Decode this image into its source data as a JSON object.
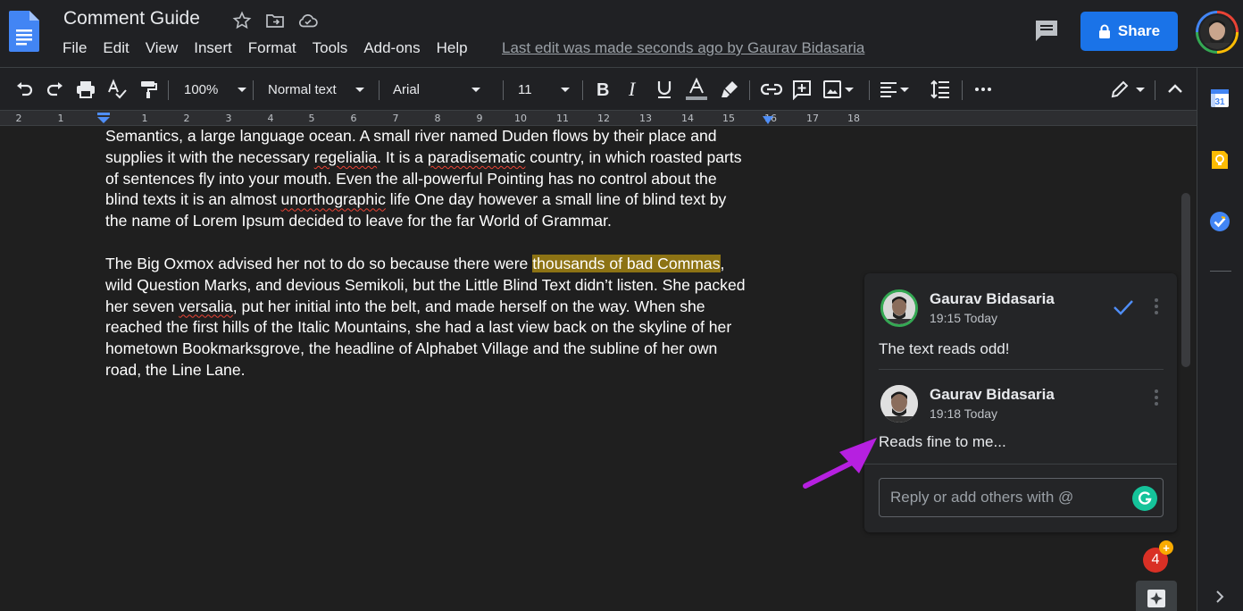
{
  "header": {
    "title": "Comment Guide",
    "menu": [
      "File",
      "Edit",
      "View",
      "Insert",
      "Format",
      "Tools",
      "Add-ons",
      "Help"
    ],
    "last_edit": "Last edit was made seconds ago by Gaurav Bidasaria",
    "share_label": "Share"
  },
  "toolbar": {
    "zoom": "100%",
    "style": "Normal text",
    "font": "Arial",
    "font_size": "11"
  },
  "ruler": {
    "labels": [
      "2",
      "1",
      "1",
      "2",
      "3",
      "4",
      "5",
      "6",
      "7",
      "8",
      "9",
      "10",
      "11",
      "12",
      "13",
      "14",
      "15",
      "16",
      "17",
      "18"
    ]
  },
  "document": {
    "paragraph1": {
      "l1": "Semantics, a large language ocean. A small river named Duden flows by their place and",
      "l2a": "supplies it with the necessary ",
      "l2b": "regelialia",
      "l2c": ". It is a ",
      "l2d": "paradisematic",
      "l2e": " country, in which roasted parts",
      "l3": "of sentences fly into your mouth. Even the all-powerful Pointing has no control about the",
      "l4a": "blind texts it is an almost ",
      "l4b": "unorthographic",
      "l4c": " life One day however a small line of blind text by",
      "l5": "the name of Lorem Ipsum decided to leave for the far World of Grammar."
    },
    "paragraph2": {
      "l1a": "The Big Oxmox advised her not to do so because there were ",
      "l1b": "thousands of bad Commas",
      "l1c": ",",
      "l2": "wild Question Marks, and devious Semikoli, but the Little Blind Text didn’t listen. She packed",
      "l3a": "her seven ",
      "l3b": "versalia",
      "l3c": ", put her initial into the belt, and made herself on the way. When she",
      "l4": "reached the first hills of the Italic Mountains, she had a last view back on the skyline of her",
      "l5": "hometown Bookmarksgrove, the headline of Alphabet Village and the subline of her own",
      "l6": "road, the Line Lane."
    }
  },
  "comments": [
    {
      "author": "Gaurav Bidasaria",
      "time": "19:15 Today",
      "text": "The text reads odd!"
    },
    {
      "author": "Gaurav Bidasaria",
      "time": "19:18 Today",
      "text": "Reads fine to me..."
    }
  ],
  "reply": {
    "placeholder": "Reply or add others with @"
  },
  "notifications": {
    "count": "4",
    "plus": "+"
  },
  "side_panel": {
    "calendar_day": "31"
  },
  "colors": {
    "share_blue": "#1a73e8",
    "highlight": "#8d7314",
    "arrow": "#b620e0",
    "resolve_check": "#4f8ef7"
  }
}
